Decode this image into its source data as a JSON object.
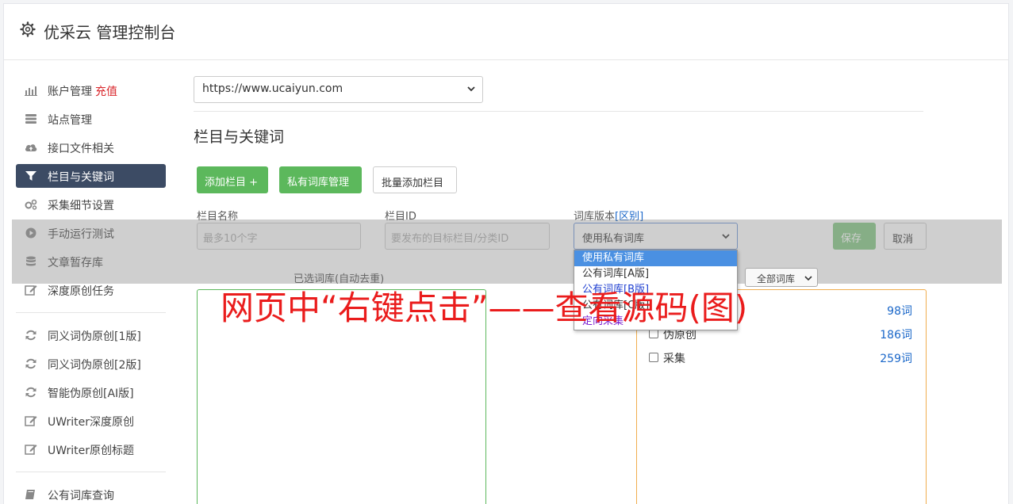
{
  "header": {
    "title": "优采云 管理控制台",
    "icon": "gear-icon"
  },
  "sidebar": {
    "items": [
      {
        "label": "账户管理",
        "extra": "充值",
        "icon": "bar-chart-icon"
      },
      {
        "label": "站点管理",
        "icon": "server-icon"
      },
      {
        "label": "接口文件相关",
        "icon": "cloud-upload-icon"
      },
      {
        "label": "栏目与关键词",
        "icon": "filter-icon",
        "active": true
      },
      {
        "label": "采集细节设置",
        "icon": "gears-icon"
      },
      {
        "label": "手动运行测试",
        "icon": "play-circle-icon"
      },
      {
        "label": "文章暂存库",
        "icon": "database-icon"
      },
      {
        "label": "深度原创任务",
        "icon": "edit-icon"
      },
      {
        "label": "同义词伪原创[1版]",
        "icon": "refresh-icon"
      },
      {
        "label": "同义词伪原创[2版]",
        "icon": "refresh-icon"
      },
      {
        "label": "智能伪原创[AI版]",
        "icon": "refresh-icon"
      },
      {
        "label": "UWriter深度原创",
        "icon": "edit-icon"
      },
      {
        "label": "UWriter原创标题",
        "icon": "edit-icon"
      },
      {
        "label": "公有词库查询",
        "icon": "book-icon"
      }
    ]
  },
  "main": {
    "site_select": "https://www.ucaiyun.com",
    "section_title": "栏目与关键词",
    "buttons": {
      "add_column": "添加栏目 +",
      "private_lexicon": "私有词库管理",
      "batch_add": "批量添加栏目"
    },
    "form": {
      "column_name_label": "栏目名称",
      "column_name_placeholder": "最多10个字",
      "column_id_label": "栏目ID",
      "column_id_placeholder": "要发布的目标栏目/分类ID",
      "lexicon_version_label": "词库版本",
      "lexicon_diff_link": "[区别]",
      "lexicon_selected": "使用私有词库",
      "save": "保存",
      "cancel": "取消"
    },
    "dropdown_options": [
      "使用私有词库",
      "公有词库[A版]",
      "公有词库[B版]",
      "公有词库[C版]",
      "定向采集"
    ],
    "selected_lexicon_label": "已选词库(自动去重)",
    "filter_select": "全部词库",
    "lexicons": [
      {
        "name": "",
        "count": "98词"
      },
      {
        "name": "伪原创",
        "count": "186词"
      },
      {
        "name": "采集",
        "count": "259词"
      }
    ]
  },
  "overlay": {
    "text": "网页中“右键点击”——查看源码(图)"
  },
  "colors": {
    "accent_green": "#5cb85c",
    "sidebar_active": "#3c4b64",
    "overlay_red": "#ea1c1c",
    "link_blue": "#1a67c9"
  }
}
